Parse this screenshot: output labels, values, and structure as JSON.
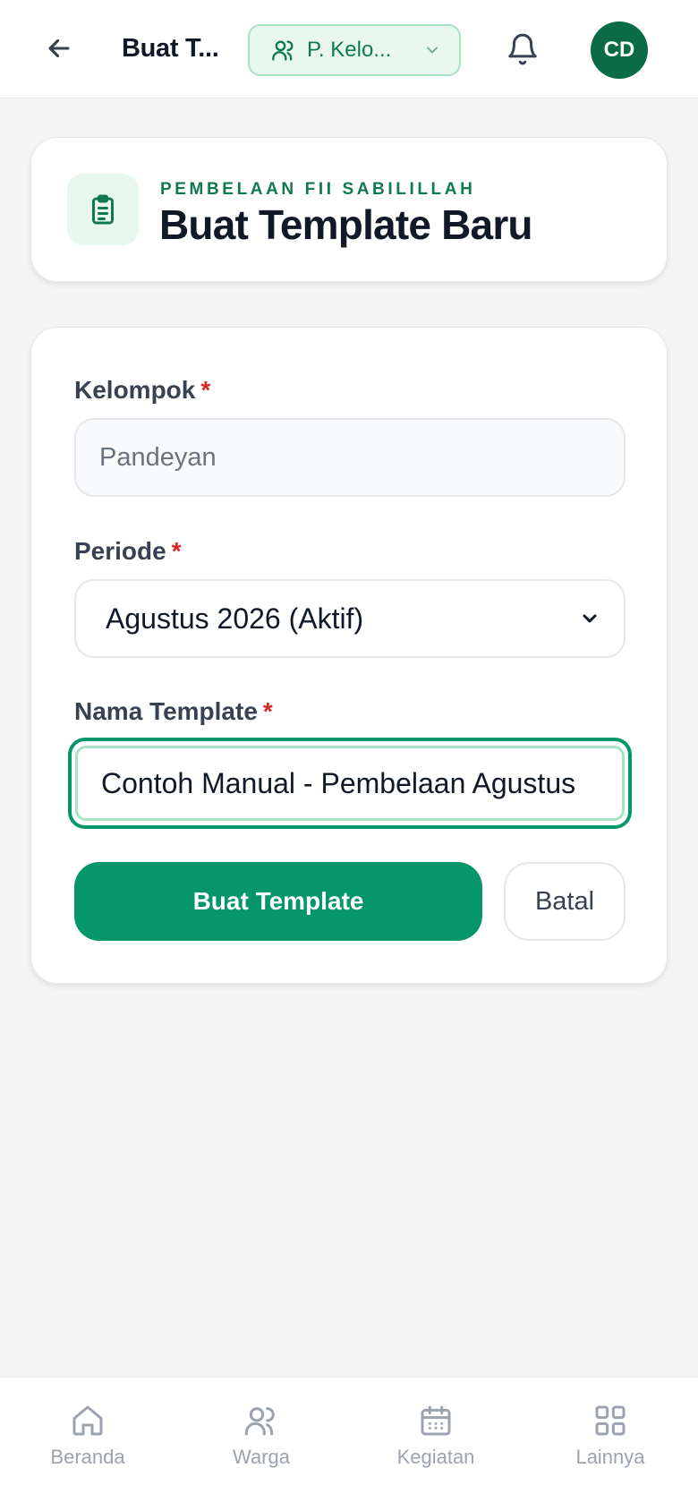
{
  "header": {
    "title": "Buat T...",
    "group_chip_label": "P. Kelo...",
    "avatar_initials": "CD"
  },
  "page_header": {
    "eyebrow": "PEMBELAAN FII SABILILLAH",
    "title": "Buat Template Baru"
  },
  "form": {
    "kelompok": {
      "label": "Kelompok",
      "required_mark": "*",
      "value": "Pandeyan"
    },
    "periode": {
      "label": "Periode",
      "required_mark": "*",
      "value": "Agustus 2026 (Aktif)"
    },
    "nama_template": {
      "label": "Nama Template",
      "required_mark": "*",
      "value": "Contoh Manual - Pembelaan Agustus"
    },
    "submit_label": "Buat Template",
    "cancel_label": "Batal"
  },
  "bottom_nav": {
    "items": [
      {
        "label": "Beranda",
        "icon": "home-icon"
      },
      {
        "label": "Warga",
        "icon": "users-icon"
      },
      {
        "label": "Kegiatan",
        "icon": "calendar-icon"
      },
      {
        "label": "Lainnya",
        "icon": "grid-icon"
      }
    ]
  },
  "colors": {
    "brand_green": "#059669",
    "dark_green": "#0b6b47",
    "required_red": "#dc2626"
  }
}
